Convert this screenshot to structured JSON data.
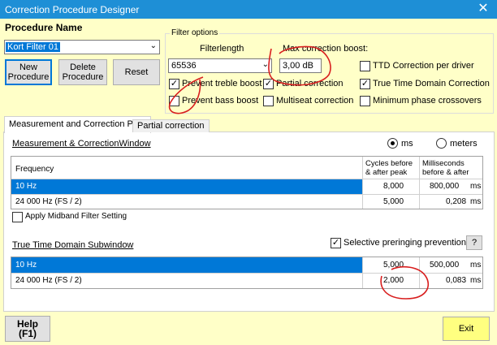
{
  "window": {
    "title": "Correction Procedure Designer",
    "close_glyph": "✕"
  },
  "procedure": {
    "heading": "Procedure Name",
    "selected": "Kort Filter 01",
    "buttons": {
      "new": "New Procedure",
      "delete": "Delete Procedure",
      "reset": "Reset"
    }
  },
  "filter_options": {
    "legend": "Filter options",
    "filterlength_label": "Filterlength",
    "filterlength_value": "65536",
    "max_boost_label": "Max correction boost:",
    "max_boost_value": "3,00 dB",
    "checkboxes": {
      "prevent_treble": {
        "label": "Prevent treble boost",
        "checked": true
      },
      "prevent_bass": {
        "label": "Prevent bass boost",
        "checked": false
      },
      "partial": {
        "label": "Partial correction",
        "checked": true
      },
      "multiseat": {
        "label": "Multiseat correction",
        "checked": false
      },
      "ttd_per_driver": {
        "label": "TTD Correction per driver",
        "checked": false
      },
      "ttd": {
        "label": "True Time Domain Correction",
        "checked": true
      },
      "min_phase": {
        "label": "Minimum phase crossovers",
        "checked": false
      }
    }
  },
  "tabs": [
    {
      "label": "Measurement and Correction Prep",
      "active": true
    },
    {
      "label": "Partial correction",
      "active": false
    }
  ],
  "measurement": {
    "title": "Measurement & CorrectionWindow",
    "unit_ms": "ms",
    "unit_meters": "meters",
    "columns": {
      "frequency": "Frequency",
      "cycles": "Cycles before & after peak",
      "ms": "Milliseconds before & after"
    },
    "rows": [
      {
        "freq": "10 Hz",
        "cycles": "8,000",
        "ms": "800,000",
        "unit": "ms",
        "selected": true
      },
      {
        "freq": "24 000 Hz (FS / 2)",
        "cycles": "5,000",
        "ms": "0,208",
        "unit": "ms",
        "selected": false
      }
    ],
    "midband_label": "Apply Midband Filter Setting"
  },
  "subwindow": {
    "title": "True Time Domain Subwindow",
    "preringing_label": "Selective preringing prevention",
    "help_glyph": "?",
    "rows": [
      {
        "freq": "10 Hz",
        "cycles": "5,000",
        "ms": "500,000",
        "unit": "ms",
        "selected": true
      },
      {
        "freq": "24 000 Hz (FS / 2)",
        "cycles": "2,000",
        "ms": "0,083",
        "unit": "ms",
        "selected": false
      }
    ]
  },
  "footer": {
    "help": "Help",
    "help_key": "(F1)",
    "exit": "Exit"
  },
  "colors": {
    "background": "#ffffc8",
    "titlebar": "#1e8fd6",
    "selection": "#0078d7",
    "annotation": "#d81e1e"
  }
}
